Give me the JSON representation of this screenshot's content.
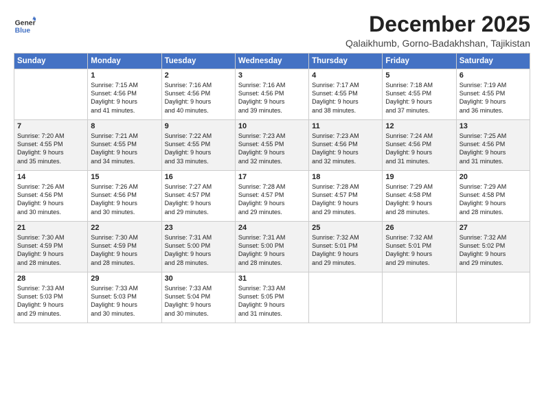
{
  "header": {
    "logo_line1": "General",
    "logo_line2": "Blue",
    "title": "December 2025",
    "location": "Qalaikhumb, Gorno-Badakhshan, Tajikistan"
  },
  "weekdays": [
    "Sunday",
    "Monday",
    "Tuesday",
    "Wednesday",
    "Thursday",
    "Friday",
    "Saturday"
  ],
  "weeks": [
    [
      {
        "day": "",
        "content": ""
      },
      {
        "day": "1",
        "content": "Sunrise: 7:15 AM\nSunset: 4:56 PM\nDaylight: 9 hours\nand 41 minutes."
      },
      {
        "day": "2",
        "content": "Sunrise: 7:16 AM\nSunset: 4:56 PM\nDaylight: 9 hours\nand 40 minutes."
      },
      {
        "day": "3",
        "content": "Sunrise: 7:16 AM\nSunset: 4:56 PM\nDaylight: 9 hours\nand 39 minutes."
      },
      {
        "day": "4",
        "content": "Sunrise: 7:17 AM\nSunset: 4:55 PM\nDaylight: 9 hours\nand 38 minutes."
      },
      {
        "day": "5",
        "content": "Sunrise: 7:18 AM\nSunset: 4:55 PM\nDaylight: 9 hours\nand 37 minutes."
      },
      {
        "day": "6",
        "content": "Sunrise: 7:19 AM\nSunset: 4:55 PM\nDaylight: 9 hours\nand 36 minutes."
      }
    ],
    [
      {
        "day": "7",
        "content": "Sunrise: 7:20 AM\nSunset: 4:55 PM\nDaylight: 9 hours\nand 35 minutes."
      },
      {
        "day": "8",
        "content": "Sunrise: 7:21 AM\nSunset: 4:55 PM\nDaylight: 9 hours\nand 34 minutes."
      },
      {
        "day": "9",
        "content": "Sunrise: 7:22 AM\nSunset: 4:55 PM\nDaylight: 9 hours\nand 33 minutes."
      },
      {
        "day": "10",
        "content": "Sunrise: 7:23 AM\nSunset: 4:55 PM\nDaylight: 9 hours\nand 32 minutes."
      },
      {
        "day": "11",
        "content": "Sunrise: 7:23 AM\nSunset: 4:56 PM\nDaylight: 9 hours\nand 32 minutes."
      },
      {
        "day": "12",
        "content": "Sunrise: 7:24 AM\nSunset: 4:56 PM\nDaylight: 9 hours\nand 31 minutes."
      },
      {
        "day": "13",
        "content": "Sunrise: 7:25 AM\nSunset: 4:56 PM\nDaylight: 9 hours\nand 31 minutes."
      }
    ],
    [
      {
        "day": "14",
        "content": "Sunrise: 7:26 AM\nSunset: 4:56 PM\nDaylight: 9 hours\nand 30 minutes."
      },
      {
        "day": "15",
        "content": "Sunrise: 7:26 AM\nSunset: 4:56 PM\nDaylight: 9 hours\nand 30 minutes."
      },
      {
        "day": "16",
        "content": "Sunrise: 7:27 AM\nSunset: 4:57 PM\nDaylight: 9 hours\nand 29 minutes."
      },
      {
        "day": "17",
        "content": "Sunrise: 7:28 AM\nSunset: 4:57 PM\nDaylight: 9 hours\nand 29 minutes."
      },
      {
        "day": "18",
        "content": "Sunrise: 7:28 AM\nSunset: 4:57 PM\nDaylight: 9 hours\nand 29 minutes."
      },
      {
        "day": "19",
        "content": "Sunrise: 7:29 AM\nSunset: 4:58 PM\nDaylight: 9 hours\nand 28 minutes."
      },
      {
        "day": "20",
        "content": "Sunrise: 7:29 AM\nSunset: 4:58 PM\nDaylight: 9 hours\nand 28 minutes."
      }
    ],
    [
      {
        "day": "21",
        "content": "Sunrise: 7:30 AM\nSunset: 4:59 PM\nDaylight: 9 hours\nand 28 minutes."
      },
      {
        "day": "22",
        "content": "Sunrise: 7:30 AM\nSunset: 4:59 PM\nDaylight: 9 hours\nand 28 minutes."
      },
      {
        "day": "23",
        "content": "Sunrise: 7:31 AM\nSunset: 5:00 PM\nDaylight: 9 hours\nand 28 minutes."
      },
      {
        "day": "24",
        "content": "Sunrise: 7:31 AM\nSunset: 5:00 PM\nDaylight: 9 hours\nand 28 minutes."
      },
      {
        "day": "25",
        "content": "Sunrise: 7:32 AM\nSunset: 5:01 PM\nDaylight: 9 hours\nand 29 minutes."
      },
      {
        "day": "26",
        "content": "Sunrise: 7:32 AM\nSunset: 5:01 PM\nDaylight: 9 hours\nand 29 minutes."
      },
      {
        "day": "27",
        "content": "Sunrise: 7:32 AM\nSunset: 5:02 PM\nDaylight: 9 hours\nand 29 minutes."
      }
    ],
    [
      {
        "day": "28",
        "content": "Sunrise: 7:33 AM\nSunset: 5:03 PM\nDaylight: 9 hours\nand 29 minutes."
      },
      {
        "day": "29",
        "content": "Sunrise: 7:33 AM\nSunset: 5:03 PM\nDaylight: 9 hours\nand 30 minutes."
      },
      {
        "day": "30",
        "content": "Sunrise: 7:33 AM\nSunset: 5:04 PM\nDaylight: 9 hours\nand 30 minutes."
      },
      {
        "day": "31",
        "content": "Sunrise: 7:33 AM\nSunset: 5:05 PM\nDaylight: 9 hours\nand 31 minutes."
      },
      {
        "day": "",
        "content": ""
      },
      {
        "day": "",
        "content": ""
      },
      {
        "day": "",
        "content": ""
      }
    ]
  ]
}
